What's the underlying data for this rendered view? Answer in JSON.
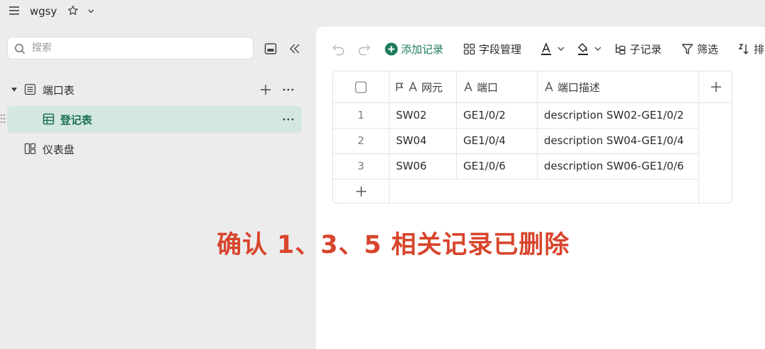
{
  "header": {
    "title": "wgsy"
  },
  "sidebar": {
    "search_placeholder": "搜索",
    "items": [
      {
        "label": "端口表"
      },
      {
        "label": "登记表"
      },
      {
        "label": "仪表盘"
      }
    ]
  },
  "toolbar": {
    "add_record": "添加记录",
    "field_manage": "字段管理",
    "sub_record": "子记录",
    "filter": "筛选",
    "sort": "排"
  },
  "colors": {
    "accent": "#1e7b5f",
    "active_row_bg": "#d4e8e0",
    "overlay_text": "#d8452c"
  },
  "table": {
    "columns": [
      "网元",
      "端口",
      "端口描述"
    ],
    "rows": [
      {
        "num": "1",
        "cells": [
          "SW02",
          "GE1/0/2",
          "description SW02-GE1/0/2"
        ]
      },
      {
        "num": "2",
        "cells": [
          "SW04",
          "GE1/0/4",
          "description SW04-GE1/0/4"
        ]
      },
      {
        "num": "3",
        "cells": [
          "SW06",
          "GE1/0/6",
          "description SW06-GE1/0/6"
        ]
      }
    ]
  },
  "overlay_text": "确认 1、3、5 相关记录已删除"
}
